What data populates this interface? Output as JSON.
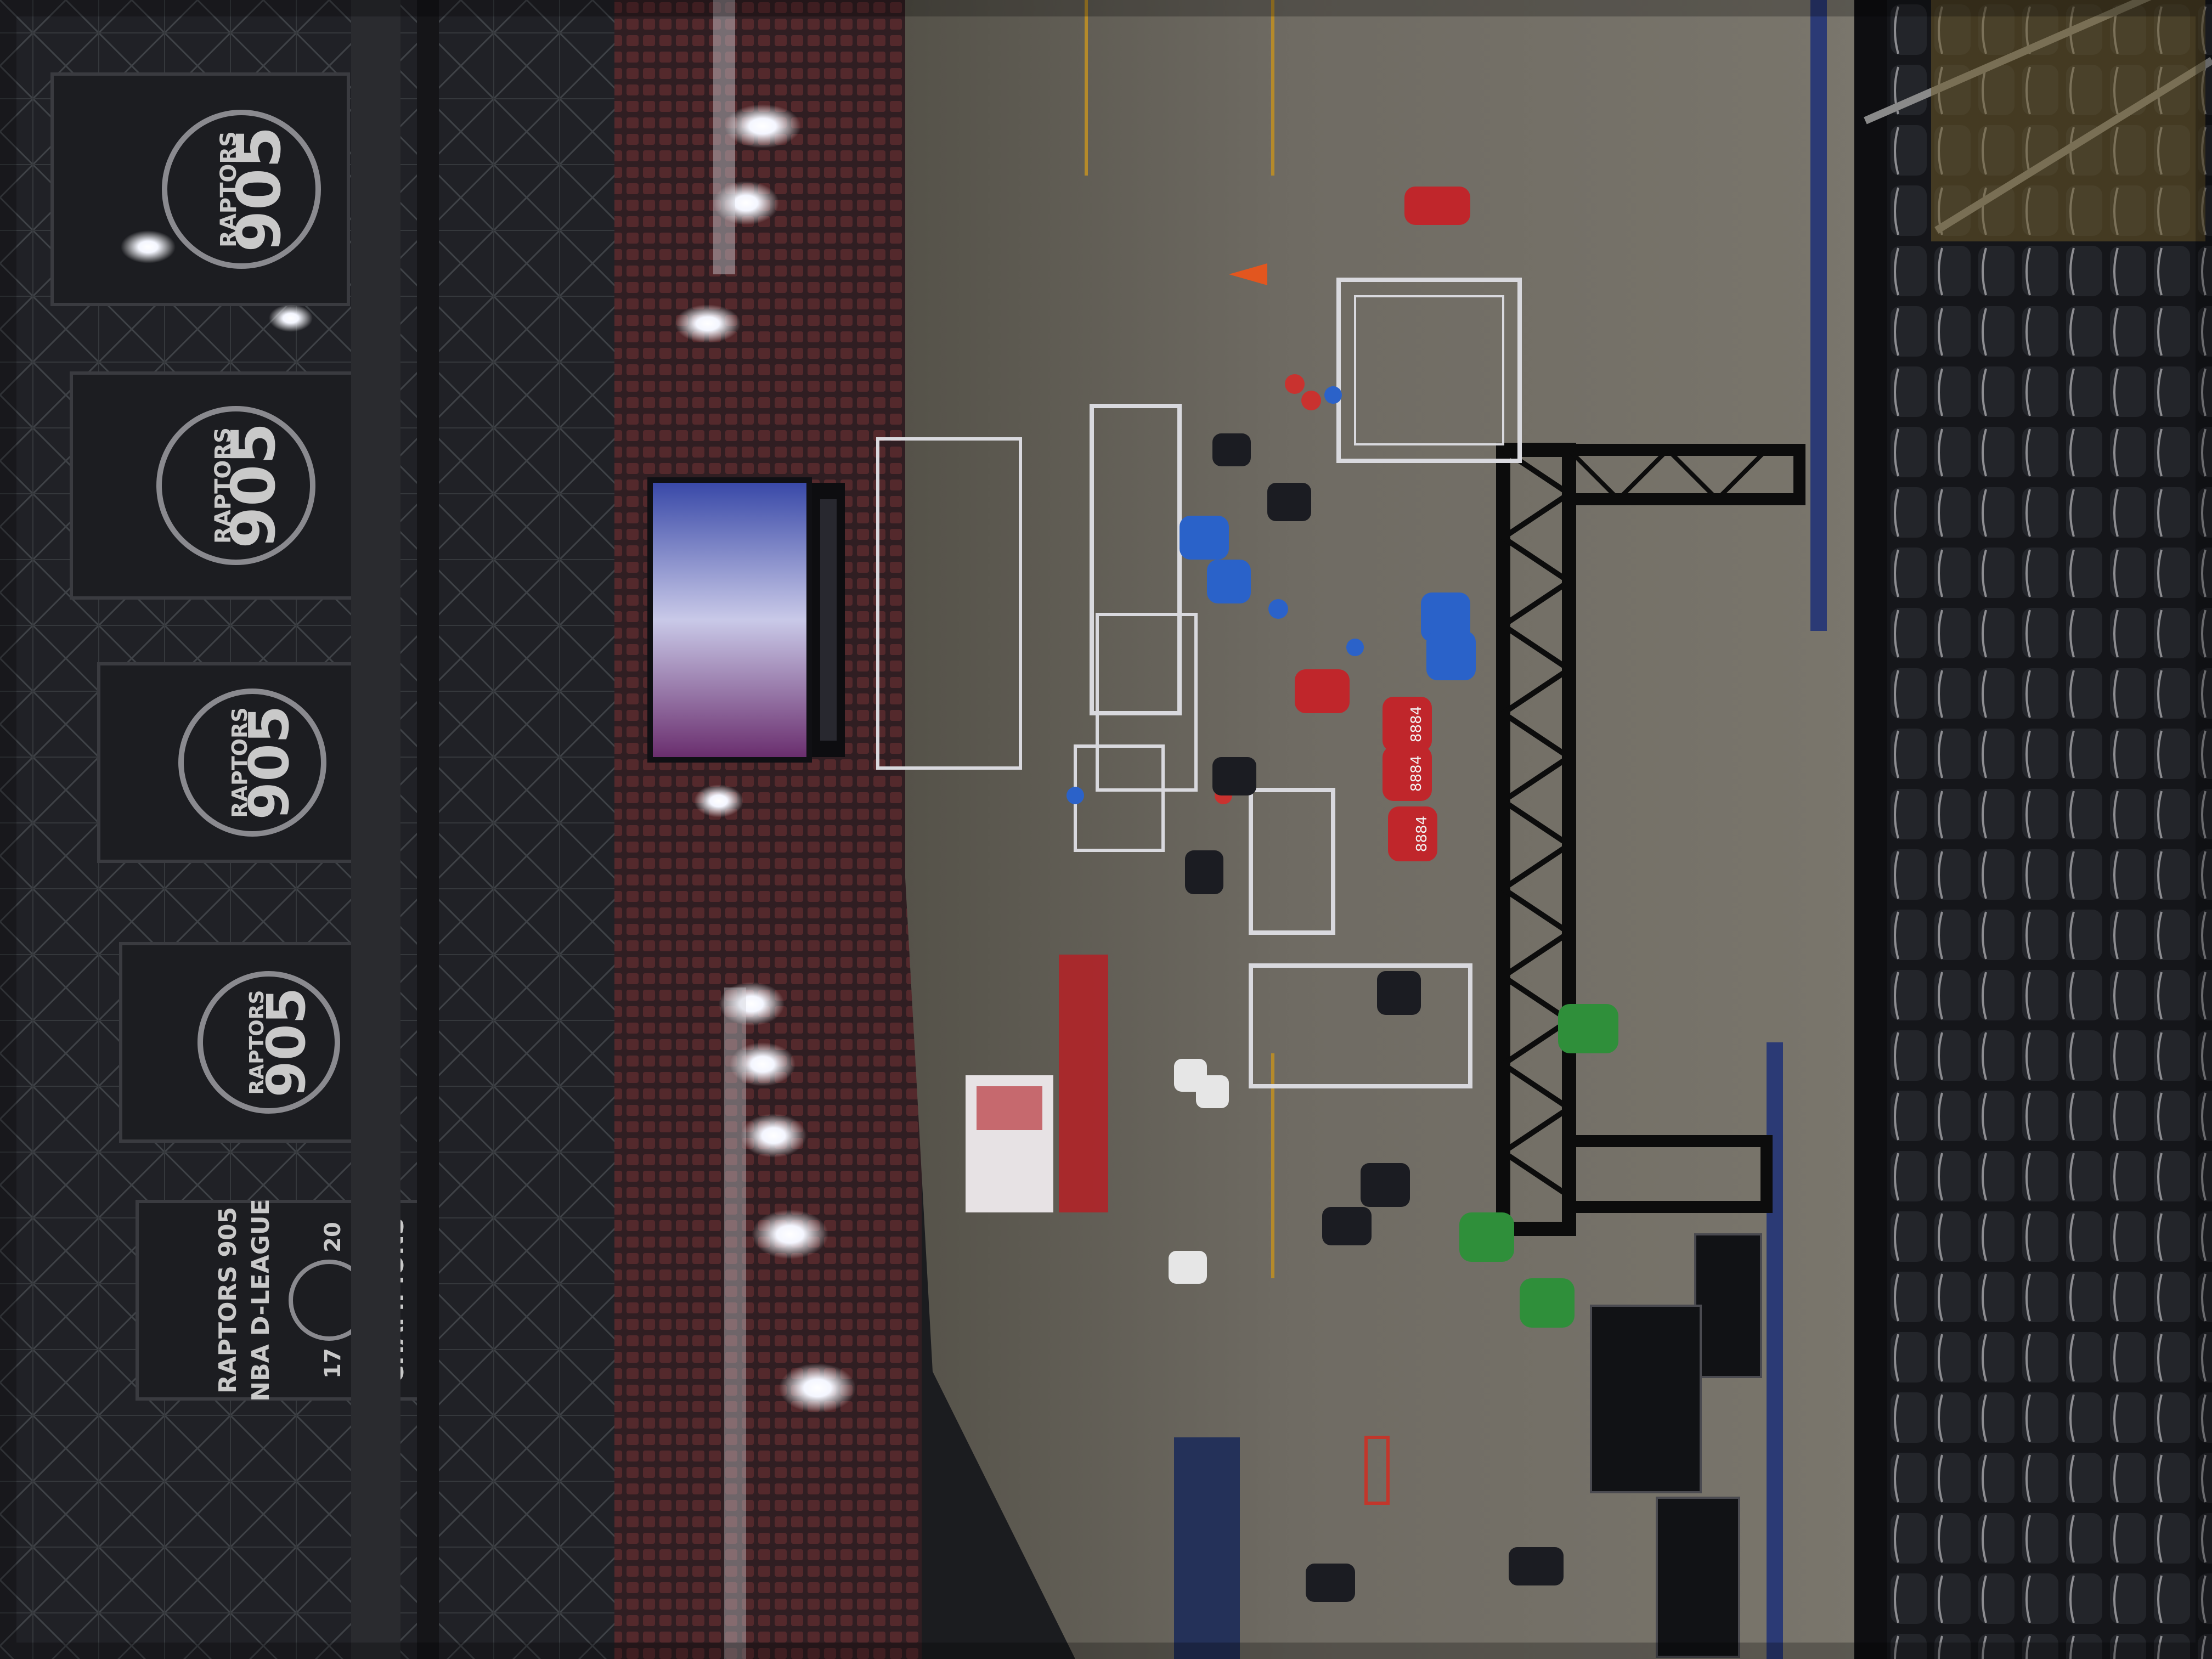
{
  "scene": {
    "description_free": true,
    "banners": [
      {
        "line1": "RAPTORS",
        "line2": "905"
      },
      {
        "line1": "RAPTORS",
        "line2": "905"
      },
      {
        "line1": "RAPTORS",
        "line2": "905"
      },
      {
        "line1": "RAPTORS",
        "line2": "905"
      },
      {
        "line1": "RAPTORS 905",
        "line2": "NBA D-LEAGUE",
        "line3": "CHAMPIONS",
        "year_left": "20",
        "year_right": "17"
      }
    ],
    "jersey_numbers": [
      "8884",
      "8884",
      "8884"
    ],
    "colors": {
      "floor": "#6e6a63",
      "seats": "#5a2f33",
      "truss": "#111111",
      "jumbotron": "#2a3a8c",
      "red_team": "#c0262b",
      "blue_team": "#2a62c9",
      "green_team": "#2f8f3a"
    }
  }
}
